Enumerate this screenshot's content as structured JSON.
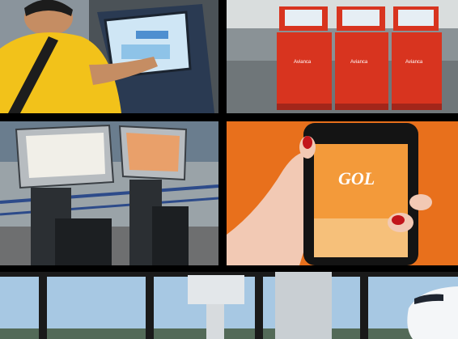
{
  "panels": {
    "kiosk_user": {
      "subject": "person using check-in kiosk"
    },
    "red_kiosks": {
      "brand_label": "Avianca"
    },
    "grey_kiosks": {
      "subject": "self-service kiosks in terminal"
    },
    "phone_app": {
      "app_title": "GOL"
    },
    "airport_window": {
      "subject": "terminal window with aircraft"
    }
  },
  "colors": {
    "shirt_yellow": "#f2c21a",
    "kiosk_red": "#d8341f",
    "gol_orange": "#e8701c",
    "sky_blue": "#a7c8e3"
  }
}
